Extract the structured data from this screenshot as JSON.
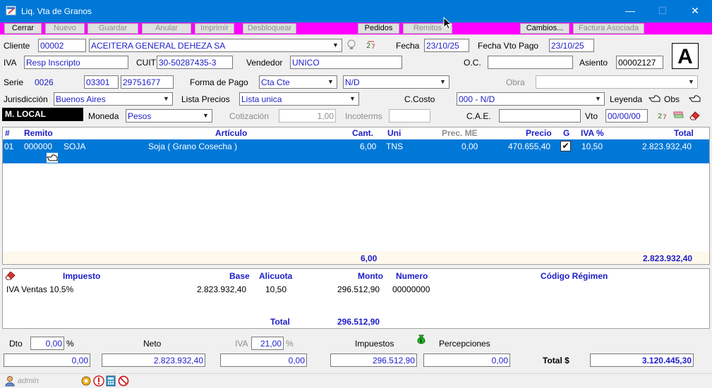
{
  "window": {
    "title": "Liq. Vta de Granos",
    "controls": {
      "minimize": "—",
      "maximize": "☐",
      "close": "✕"
    }
  },
  "toolbar": {
    "cerrar": "Cerrar",
    "nuevo": "Nuevo",
    "guardar": "Guardar",
    "anular": "Anular",
    "imprimir": "Imprimir",
    "desbloquear": "Desbloquear",
    "pedidos": "Pedidos",
    "remitos": "Remitos",
    "cambios": "Cambios...",
    "factura_asociada": "Factura Asociada"
  },
  "header": {
    "cliente_label": "Cliente",
    "cliente_code": "00002",
    "cliente_name": "ACEITERA GENERAL DEHEZA SA",
    "fecha_label": "Fecha",
    "fecha": "23/10/25",
    "fecha_vto_label": "Fecha Vto Pago",
    "fecha_vto": "23/10/25",
    "iva_label": "IVA",
    "iva": "Resp Inscripto",
    "cuit_label": "CUIT",
    "cuit": "30-50287435-3",
    "vendedor_label": "Vendedor",
    "vendedor": "UNICO",
    "oc_label": "O.C.",
    "oc": "",
    "asiento_label": "Asiento",
    "asiento": "00002127",
    "letra": "A",
    "serie_label": "Serie",
    "serie": "0026",
    "serie_pv": "03301",
    "serie_num": "29751677",
    "forma_pago_label": "Forma de Pago",
    "forma_pago": "Cta Cte",
    "forma_pago_2": "N/D",
    "obra_label": "Obra",
    "obra": "",
    "jurisdiccion_label": "Jurisdicción",
    "jurisdiccion": "Buenos Aires",
    "lista_precios_label": "Lista Precios",
    "lista_precios": "Lista unica",
    "ccosto_label": "C.Costo",
    "ccosto": "000 - N/D",
    "leyenda_label": "Leyenda",
    "obs_label": "Obs",
    "mlocal": "M. LOCAL",
    "moneda_label": "Moneda",
    "moneda": "Pesos",
    "cotizacion_label": "Cotización",
    "cotizacion": "1,00",
    "incoterms_label": "Incoterms",
    "incoterms": "",
    "cae_label": "C.A.E.",
    "cae": "",
    "vto_label": "Vto",
    "vto": "00/00/00"
  },
  "items": {
    "columns": {
      "num": "#",
      "remito": "Remito",
      "articulo": "Artículo",
      "cant": "Cant.",
      "uni": "Uni",
      "prec_me": "Prec. ME",
      "precio": "Precio",
      "g": "G",
      "iva": "IVA %",
      "total": "Total"
    },
    "rows": [
      {
        "num": "01",
        "remito": "000000",
        "code": "SOJA",
        "articulo": "Soja ( Grano Cosecha )",
        "cant": "6,00",
        "uni": "TNS",
        "prec_me": "0,00",
        "precio": "470.655,40",
        "g": "✔",
        "iva": "10,50",
        "total": "2.823.932,40"
      }
    ],
    "footer": {
      "cant": "6,00",
      "total": "2.823.932,40"
    }
  },
  "taxes": {
    "columns": {
      "impuesto": "Impuesto",
      "base": "Base",
      "alicuota": "Alicuota",
      "monto": "Monto",
      "numero": "Numero",
      "codigo": "Código Régimen"
    },
    "rows": [
      {
        "impuesto": "IVA Ventas 10.5%",
        "base": "2.823.932,40",
        "alicuota": "10,50",
        "monto": "296.512,90",
        "numero": "00000000",
        "codigo": ""
      }
    ],
    "total_label": "Total",
    "total": "296.512,90"
  },
  "summary": {
    "dto_label": "Dto",
    "dto_pct": "0,00",
    "pct_sign": "%",
    "neto_label": "Neto",
    "iva_label": "IVA",
    "iva_pct": "21,00",
    "iva_pct_sign": "%",
    "impuestos_label": "Impuestos",
    "percepciones_label": "Percepciones",
    "dto_amount": "0,00",
    "neto": "2.823.932,40",
    "iva_amount": "0,00",
    "impuestos": "296.512,90",
    "percepciones": "0,00",
    "total_label": "Total $",
    "total": "3.120.445,30"
  },
  "status": {
    "user": "admin"
  },
  "colors": {
    "titlebar": "#0078d7",
    "toolbar": "#ff00ff",
    "selection": "#0078d7",
    "field_text": "#1c1cc8"
  }
}
